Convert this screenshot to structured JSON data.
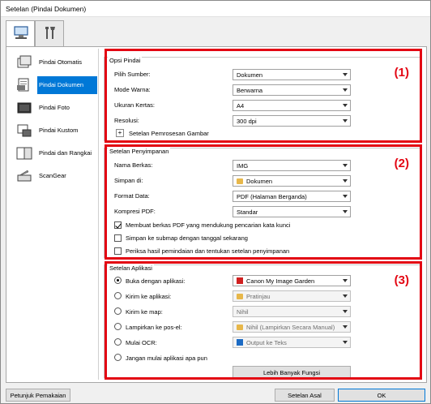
{
  "window": {
    "title": "Setelan (Pindai Dokumen)"
  },
  "tabs": [
    {
      "icon": "computer-icon"
    },
    {
      "icon": "tools-icon"
    }
  ],
  "nav": [
    {
      "label": "Pindai Otomatis",
      "icon": "auto-scan-icon"
    },
    {
      "label": "Pindai Dokumen",
      "icon": "document-scan-icon",
      "selected": true
    },
    {
      "label": "Pindai Foto",
      "icon": "photo-scan-icon"
    },
    {
      "label": "Pindai Kustom",
      "icon": "custom-scan-icon"
    },
    {
      "label": "Pindai dan Rangkai",
      "icon": "stitch-scan-icon"
    },
    {
      "label": "ScanGear",
      "icon": "scangear-icon"
    }
  ],
  "scan_options": {
    "title": "Opsi Pindai",
    "number": "(1)",
    "fields": [
      {
        "label": "Pilih Sumber:",
        "value": "Dokumen"
      },
      {
        "label": "Mode Warna:",
        "value": "Berwarna"
      },
      {
        "label": "Ukuran Kertas:",
        "value": "A4"
      },
      {
        "label": "Resolusi:",
        "value": "300 dpi"
      }
    ],
    "expand_label": "Setelan Pemrosesan Gambar"
  },
  "save_settings": {
    "title": "Setelan Penyimpanan",
    "number": "(2)",
    "fields": [
      {
        "label": "Nama Berkas:",
        "value": "IMG"
      },
      {
        "label": "Simpan di:",
        "value": "Dokumen"
      },
      {
        "label": "Format Data:",
        "value": "PDF (Halaman Berganda)"
      },
      {
        "label": "Kompresi PDF:",
        "value": "Standar"
      }
    ],
    "checkboxes": [
      {
        "label": "Membuat berkas PDF yang mendukung pencarian kata kunci",
        "checked": true
      },
      {
        "label": "Simpan ke submap dengan tanggal sekarang",
        "checked": false
      },
      {
        "label": "Periksa hasil pemindaian dan tentukan setelan penyimpanan",
        "checked": false
      }
    ]
  },
  "app_settings": {
    "title": "Setelan Aplikasi",
    "number": "(3)",
    "options": [
      {
        "label": "Buka dengan aplikasi:",
        "value": "Canon My Image Garden",
        "selected": true,
        "enabled": true
      },
      {
        "label": "Kirim ke aplikasi:",
        "value": "Pratinjau",
        "selected": false,
        "enabled": false
      },
      {
        "label": "Kirim ke map:",
        "value": "Nihil",
        "selected": false,
        "enabled": false
      },
      {
        "label": "Lampirkan ke pos-el:",
        "value": "Nihil (Lampirkan Secara Manual)",
        "selected": false,
        "enabled": false
      },
      {
        "label": "Mulai OCR:",
        "value": "Output ke Teks",
        "selected": false,
        "enabled": false
      },
      {
        "label": "Jangan mulai aplikasi apa pun",
        "selected": false
      }
    ],
    "more_button": "Lebih Banyak Fungsi"
  },
  "footer": {
    "help_button": "Petunjuk Pemakaian",
    "defaults_button": "Setelan Asal",
    "ok_button": "OK"
  },
  "colors": {
    "highlight": "#e30613",
    "selection": "#0078d7"
  }
}
